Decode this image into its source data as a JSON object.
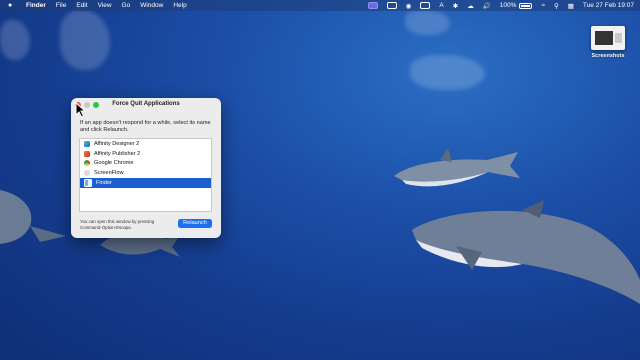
{
  "menubar": {
    "app_name": "Finder",
    "items": [
      "File",
      "Edit",
      "View",
      "Go",
      "Window",
      "Help"
    ],
    "battery_percent": "100%",
    "datetime": "Tue 27 Feb  19:07",
    "input_source": "A"
  },
  "desktop": {
    "items": [
      {
        "label": "Screenshots",
        "icon": "screenshot-thumbnail"
      }
    ]
  },
  "force_quit_window": {
    "title": "Force Quit Applications",
    "description": "If an app doesn’t respond for a while, select its name and click Relaunch.",
    "apps": [
      {
        "name": "Affinity Designer 2",
        "icon": "affinity-designer-icon",
        "selected": false
      },
      {
        "name": "Affinity Publisher 2",
        "icon": "affinity-publisher-icon",
        "selected": false
      },
      {
        "name": "Google Chrome",
        "icon": "chrome-icon",
        "selected": false
      },
      {
        "name": "ScreenFlow",
        "icon": "screenflow-icon",
        "selected": false
      },
      {
        "name": "Finder",
        "icon": "finder-icon",
        "selected": true
      }
    ],
    "footer_note": "You can open this window by pressing Command-Option-Escape.",
    "relaunch_label": "Relaunch"
  },
  "colors": {
    "selection": "#1d5fd1",
    "button": "#1d6ff2",
    "close_button": "#fe5f57",
    "zoom_button": "#28c840"
  }
}
